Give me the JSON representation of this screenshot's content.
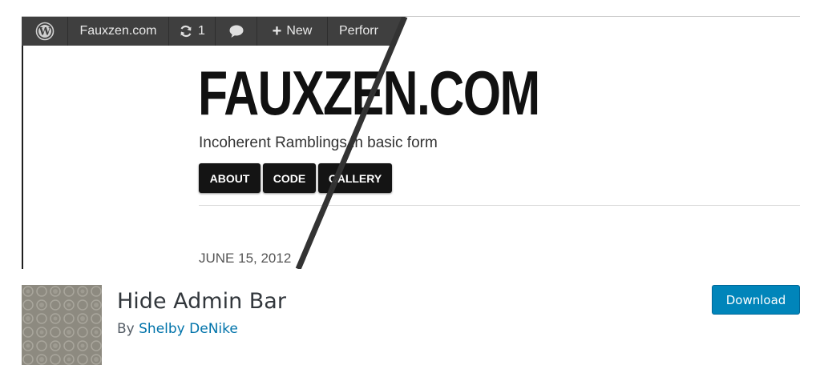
{
  "banner": {
    "adminbar": {
      "site_name": "Fauxzen.com",
      "updates_count": "1",
      "new_label": "New",
      "truncated_item": "Perforr"
    },
    "site_logo": "FAUXZEN.COM",
    "tagline": "Incoherent Ramblings in basic form",
    "nav": [
      "ABOUT",
      "CODE",
      "GALLERY"
    ],
    "post_date": "JUNE 15, 2012"
  },
  "plugin": {
    "title": "Hide Admin Bar",
    "by_prefix": "By",
    "author": "Shelby DeNike",
    "download_label": "Download"
  },
  "colors": {
    "admin_bar": "#3f3f3f",
    "download_button": "#0085ba",
    "author_link": "#0073aa"
  }
}
